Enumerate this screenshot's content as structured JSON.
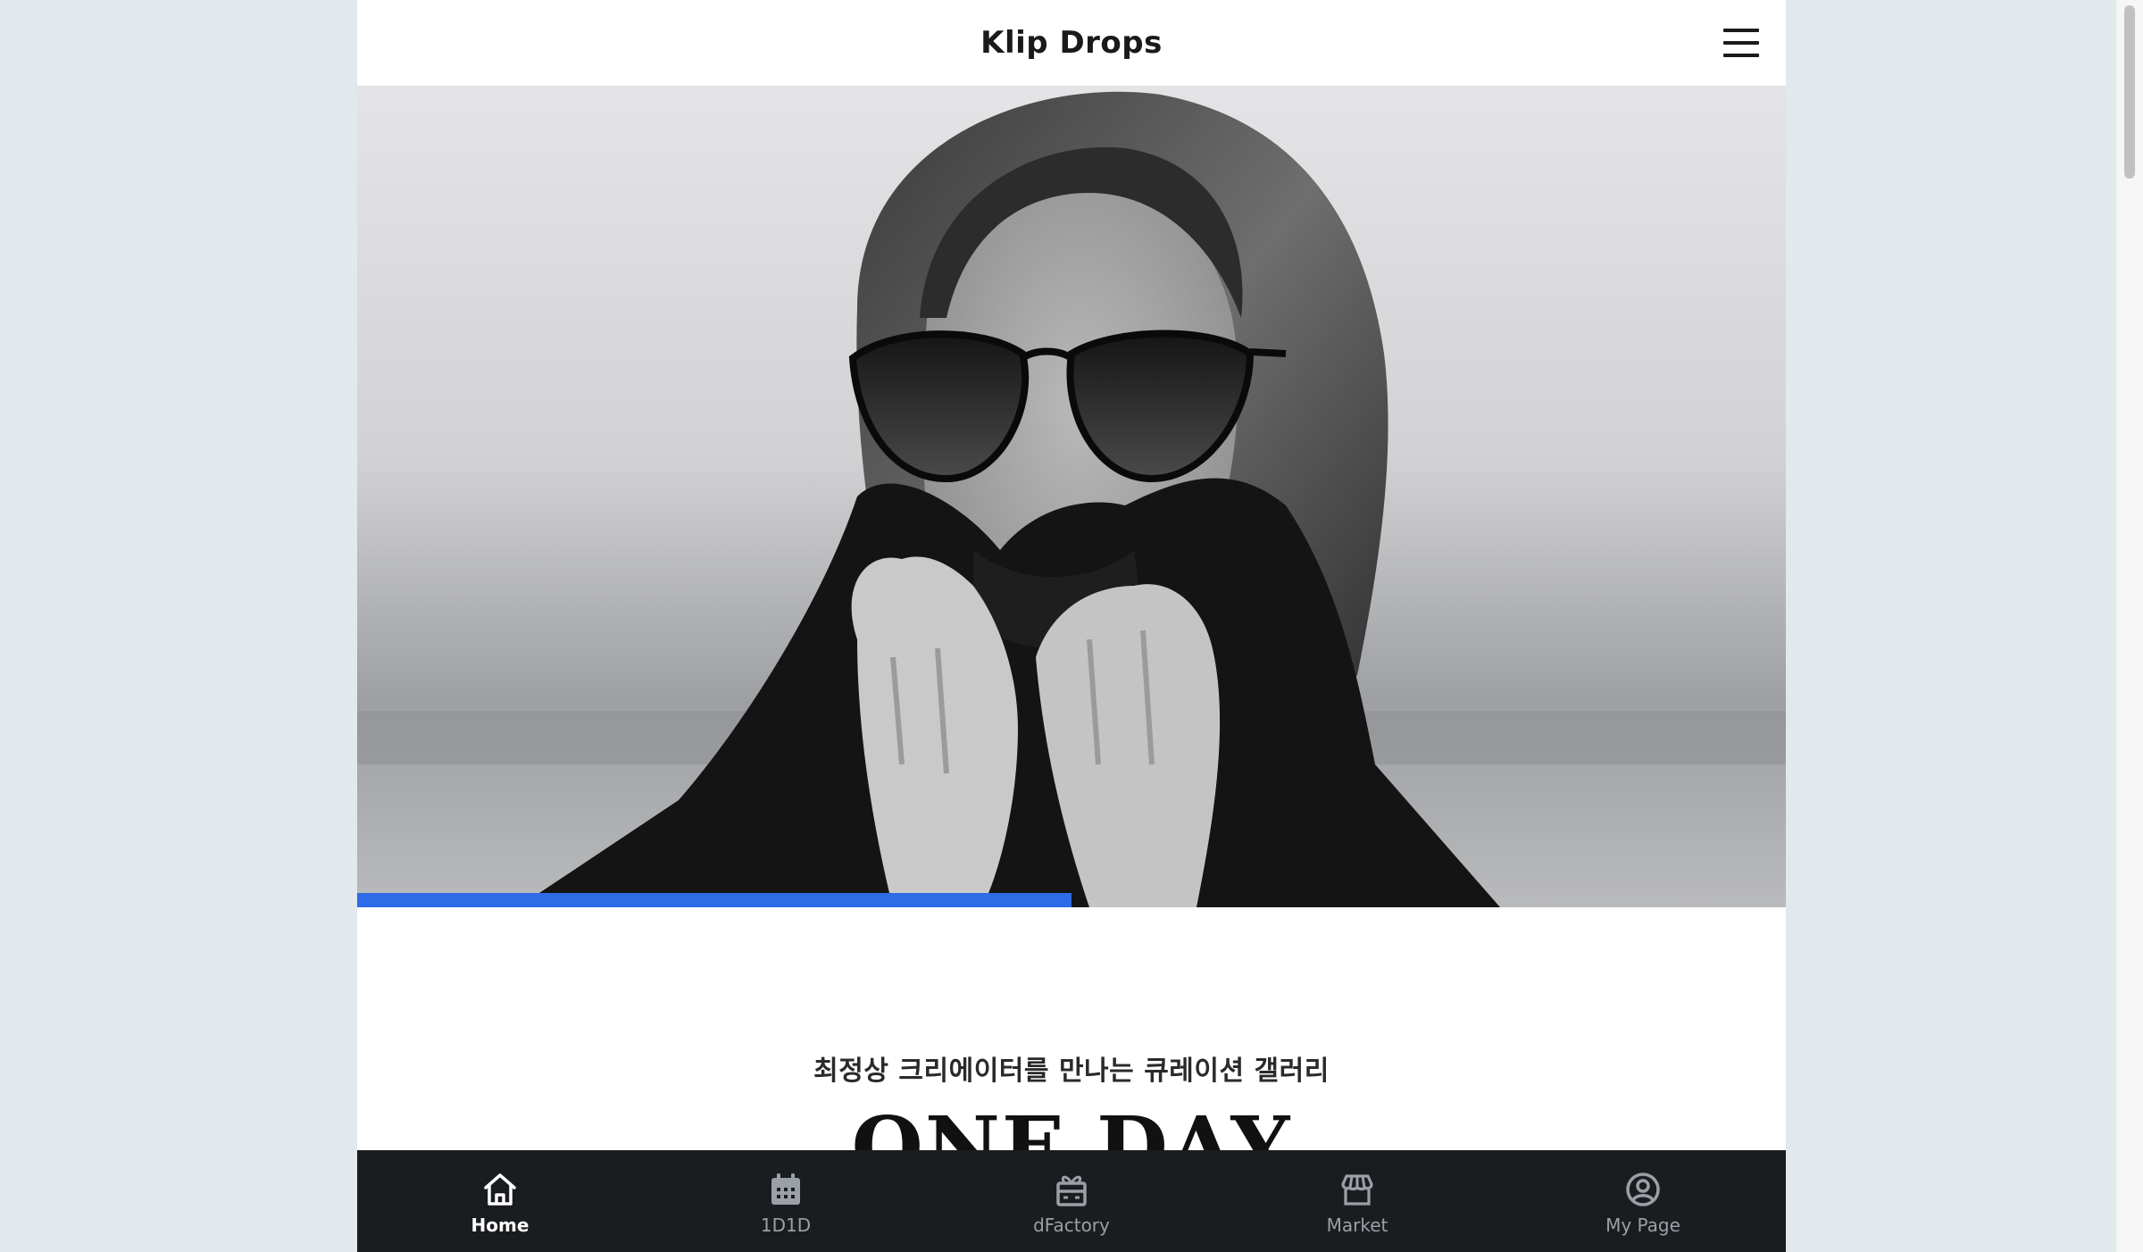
{
  "header": {
    "brand": "Klip Drops",
    "menu_icon": "hamburger-menu-icon"
  },
  "hero": {
    "image_subject": "portrait-photo",
    "slide_progress": 0.5
  },
  "content": {
    "subtitle": "최정상 크리에이터를 만나는 큐레이션 갤러리",
    "title": "ONE DAY"
  },
  "bottom_nav": {
    "items": [
      {
        "label": "Home",
        "icon": "home-icon",
        "active": true
      },
      {
        "label": "1D1D",
        "icon": "calendar-icon",
        "active": false
      },
      {
        "label": "dFactory",
        "icon": "gift-box-icon",
        "active": false
      },
      {
        "label": "Market",
        "icon": "storefront-icon",
        "active": false
      },
      {
        "label": "My Page",
        "icon": "user-circle-icon",
        "active": false
      }
    ]
  },
  "colors": {
    "progress_accent": "#2e6be6",
    "nav_background": "#1a1d20",
    "page_background": "#e1e9ed"
  }
}
